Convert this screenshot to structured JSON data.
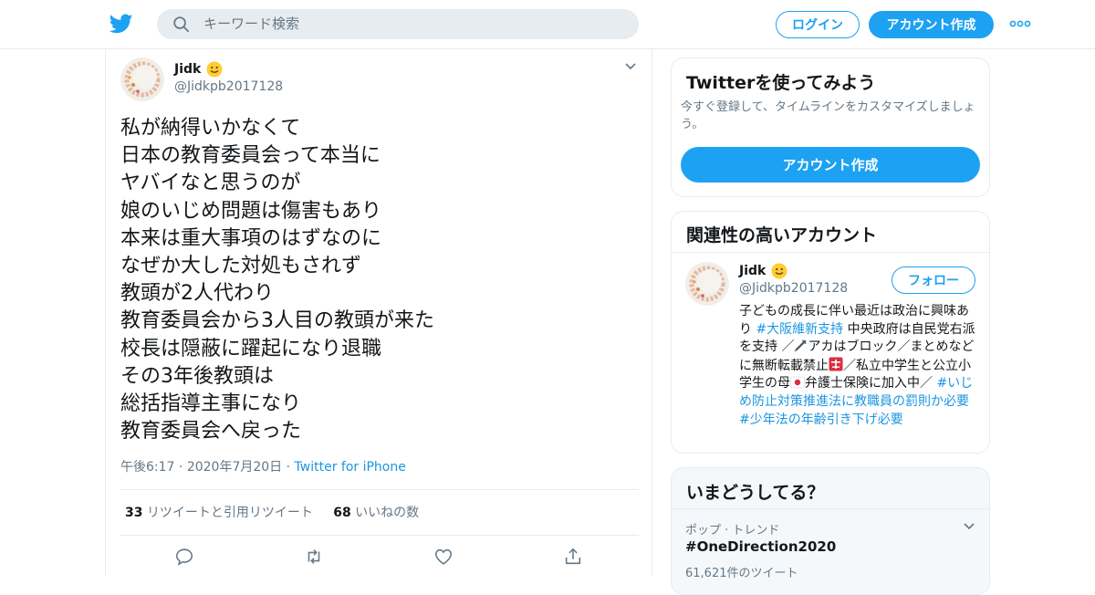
{
  "header": {
    "search_placeholder": "キーワード検索",
    "login_label": "ログイン",
    "signup_label": "アカウント作成"
  },
  "tweet": {
    "author_name": "Jidk",
    "author_handle": "@Jidkpb2017128",
    "lines": [
      "私が納得いかなくて",
      "日本の教育委員会って本当に",
      "ヤバイなと思うのが",
      "娘のいじめ問題は傷害もあり",
      "本来は重大事項のはずなのに",
      "なぜか大した対処もされず",
      "教頭が2人代わり",
      "教育委員会から3人目の教頭が来た",
      "校長は隠蔽に躍起になり退職",
      "その3年後教頭は",
      "総括指導主事になり",
      "教育委員会へ戻った"
    ],
    "time": "午後6:17",
    "date": "2020年7月20日",
    "source": "Twitter for iPhone",
    "retweet_count": "33",
    "retweet_label": "リツイートと引用リツイート",
    "like_count": "68",
    "like_label": "いいねの数"
  },
  "sidebar": {
    "signup_card": {
      "title": "Twitterを使ってみよう",
      "subtitle": "今すぐ登録して、タイムラインをカスタマイズしましょう。",
      "button_label": "アカウント作成"
    },
    "related_card": {
      "title": "関連性の高いアカウント",
      "name": "Jidk",
      "handle": "@Jidkpb2017128",
      "follow_label": "フォロー",
      "bio": {
        "p1": "子どもの成長に伴い最近は政治に興味あり ",
        "tag1": "#大阪維新支持",
        "p2": " 中央政府は自民党右派を支持 ／",
        "p3": "アカはブロック／まとめなどに無断転載禁止",
        "p4": "／私立中学生と公立小学生の母",
        "p5": "弁護士保険に加入中／ ",
        "tag2": "#いじめ防止対策推進法に教職員の罰則か必要",
        "p6": " ",
        "tag3": "#少年法の年齢引き下げ必要"
      }
    },
    "trends_card": {
      "title": "いまどうしてる？",
      "category": "ポップ · トレンド",
      "trend_name": "#OneDirection2020",
      "tweet_count": "61,621件のツイート"
    }
  },
  "colors": {
    "brand_blue": "#1da1f2",
    "link_blue": "#1b95e0",
    "muted_gray": "#657786",
    "border": "#e6ecf0"
  },
  "icons": [
    "twitter-bird-icon",
    "search-icon",
    "more-dots-icon",
    "chevron-down-icon",
    "reply-icon",
    "retweet-icon",
    "like-icon",
    "share-icon",
    "smiley-emoji-icon",
    "syringe-emoji-icon",
    "prohibited-emoji-icon",
    "japan-flag-emoji-icon"
  ]
}
